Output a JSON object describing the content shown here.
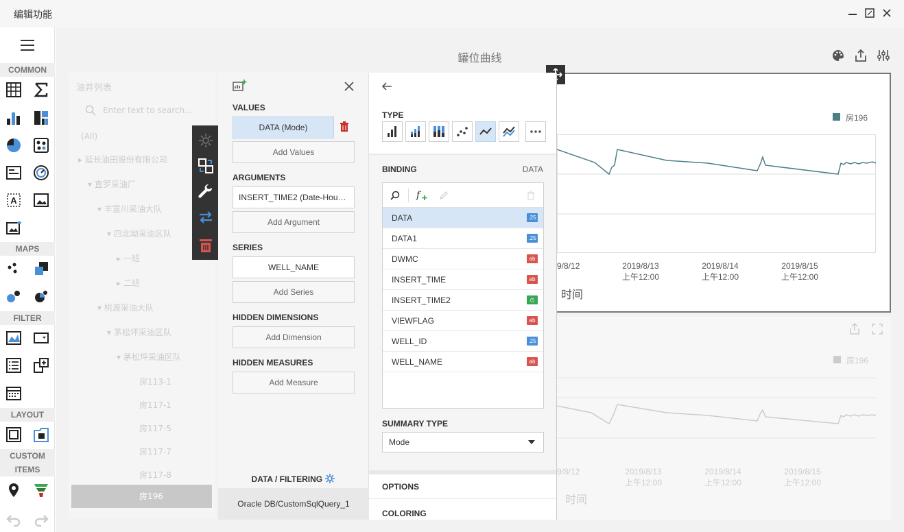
{
  "window": {
    "title": "编辑功能"
  },
  "toolbox": {
    "sections": [
      "COMMON",
      "MAPS",
      "FILTER",
      "LAYOUT",
      "CUSTOM",
      "ITEMS"
    ]
  },
  "dashboard": {
    "title": "罐位曲线"
  },
  "left_list": {
    "title": "油井列表",
    "search_placeholder": "Enter text to search...",
    "items": [
      "(All)",
      "延长油田股份有限公司",
      "直罗采油厂",
      "丰富川采油大队",
      "四北坳采油区队",
      "一班",
      "二班",
      "桃渡采油大队",
      "茅松坪采油区队",
      "茅松坪采油区队",
      "房113-1",
      "房117-1",
      "房117-5",
      "房117-7",
      "房117-8",
      "房196"
    ]
  },
  "editor": {
    "values_label": "VALUES",
    "values_item": "DATA (Mode)",
    "add_values": "Add Values",
    "arguments_label": "ARGUMENTS",
    "arguments_item": "INSERT_TIME2 (Date-Hour-...",
    "add_argument": "Add Argument",
    "series_label": "SERIES",
    "series_item": "WELL_NAME",
    "add_series": "Add Series",
    "hidden_dimensions_label": "HIDDEN DIMENSIONS",
    "add_dimension": "Add Dimension",
    "hidden_measures_label": "HIDDEN MEASURES",
    "add_measure": "Add Measure",
    "data_filtering": "DATA / FILTERING",
    "datasource": "Oracle DB/CustomSqlQuery_1"
  },
  "editor2": {
    "type_label": "TYPE",
    "binding_label": "BINDING",
    "data_label": "DATA",
    "fields": [
      {
        "name": "DATA",
        "type": ".25",
        "color": "#4a90d9"
      },
      {
        "name": "DATA1",
        "type": ".25",
        "color": "#4a90d9"
      },
      {
        "name": "DWMC",
        "type": "ab",
        "color": "#d9534f"
      },
      {
        "name": "INSERT_TIME",
        "type": "ab",
        "color": "#d9534f"
      },
      {
        "name": "INSERT_TIME2",
        "type": "◷",
        "color": "#3aa655"
      },
      {
        "name": "VIEWFLAG",
        "type": "ab",
        "color": "#d9534f"
      },
      {
        "name": "WELL_ID",
        "type": ".25",
        "color": "#4a90d9"
      },
      {
        "name": "WELL_NAME",
        "type": "ab",
        "color": "#d9534f"
      }
    ],
    "summary_type_label": "SUMMARY TYPE",
    "summary_type_value": "Mode",
    "options_label": "OPTIONS",
    "coloring_label": "COLORING"
  },
  "chart": {
    "legend": "房196",
    "x_ticks": [
      {
        "date": "9/8/12",
        "time": ""
      },
      {
        "date": "2019/8/13",
        "time": "上午12:00"
      },
      {
        "date": "2019/8/14",
        "time": "上午12:00"
      },
      {
        "date": "2019/8/15",
        "time": "上午12:00"
      }
    ],
    "xlabel": "时间",
    "line_color": "#4e7f87"
  }
}
